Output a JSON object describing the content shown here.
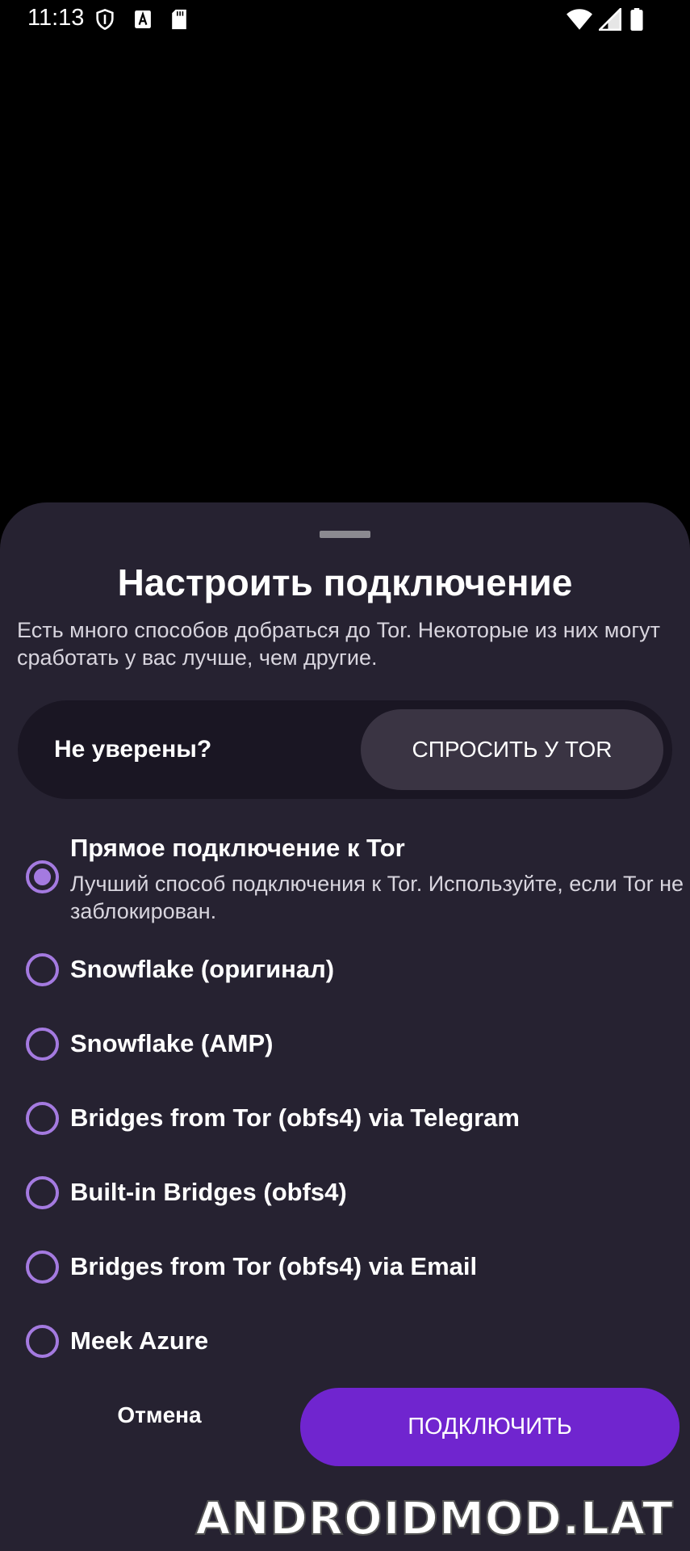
{
  "status_bar": {
    "time": "11:13",
    "icons": [
      "shield-icon",
      "text-a-icon",
      "sd-card-icon",
      "wifi-icon",
      "signal-icon",
      "battery-icon"
    ]
  },
  "sheet": {
    "title": "Настроить подключение",
    "subtitle": "Есть много способов добраться до Tor. Некоторые из них могут сработать у вас лучше, чем другие.",
    "unsure": {
      "label": "Не уверены?",
      "ask_button": "СПРОСИТЬ У TOR"
    },
    "options": [
      {
        "label": "Прямое подключение к Tor",
        "description": "Лучший способ подключения к Tor. Используйте, если Tor не заблокирован.",
        "selected": true
      },
      {
        "label": "Snowflake (оригинал)",
        "selected": false
      },
      {
        "label": "Snowflake (AMP)",
        "selected": false
      },
      {
        "label": "Bridges from Tor (obfs4) via Telegram",
        "selected": false
      },
      {
        "label": "Built-in Bridges (obfs4)",
        "selected": false
      },
      {
        "label": "Bridges from Tor (obfs4) via Email",
        "selected": false
      },
      {
        "label": "Meek Azure",
        "selected": false
      }
    ],
    "cancel_button": "Отмена",
    "connect_button": "ПОДКЛЮЧИТЬ"
  },
  "watermark": "ANDROIDMOD.LAT",
  "colors": {
    "sheet_background": "#262231",
    "accent": "#7025cf",
    "radio": "#a47ae0"
  }
}
